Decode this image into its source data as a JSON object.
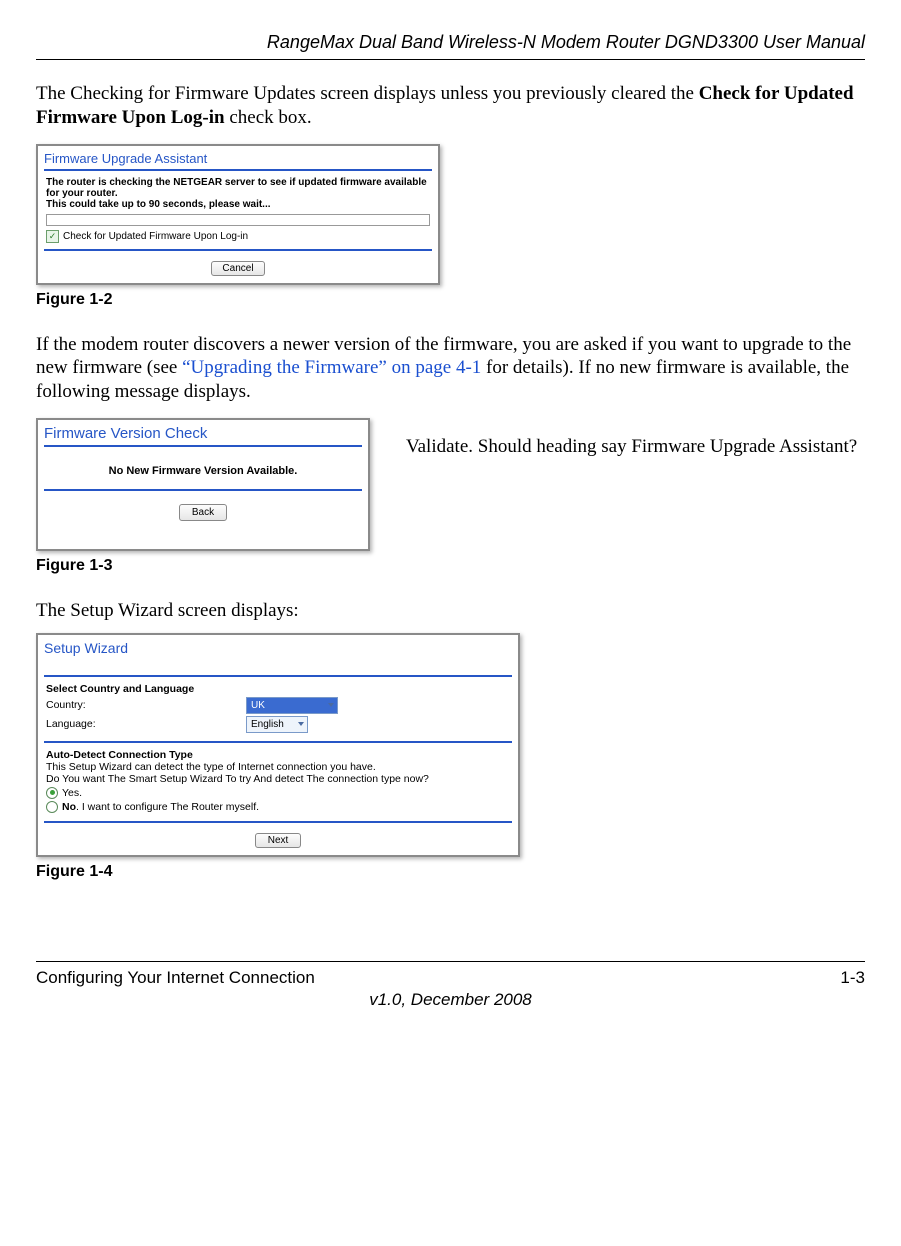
{
  "header": {
    "title": "RangeMax Dual Band Wireless-N Modem Router DGND3300 User Manual"
  },
  "para1_a": "The Checking for Firmware Updates screen displays unless you previously cleared the ",
  "para1_b_bold": "Check for Updated Firmware Upon Log-in",
  "para1_c": " check box.",
  "fig1": {
    "title": "Firmware Upgrade Assistant",
    "line1": "The router is checking the NETGEAR server to see if updated firmware available for your router.",
    "line2": "This could take up to 90 seconds, please wait...",
    "check_label": "Check for Updated Firmware Upon Log-in",
    "button": "Cancel",
    "caption": "Figure 1-2"
  },
  "para2_a": "If the modem router discovers a newer version of the firmware, you are asked if you want to upgrade to the new firmware (see ",
  "para2_link": "“Upgrading the Firmware” on page 4-1",
  "para2_b": " for details). If no new firmware is available, the following message displays.",
  "fig2": {
    "title": "Firmware Version Check",
    "message": "No New Firmware Version Available.",
    "button": "Back",
    "caption": "Figure 1-3"
  },
  "annotation": "Validate. Should heading say Firmware Upgrade Assistant?",
  "para3": "The Setup Wizard screen displays:",
  "fig3": {
    "title": "Setup Wizard",
    "section1": "Select Country and Language",
    "country_label": "Country:",
    "country_value": "UK",
    "language_label": "Language:",
    "language_value": "English",
    "section2": "Auto-Detect Connection Type",
    "desc1": "This Setup Wizard can detect the type of Internet connection you have.",
    "desc2": "Do You want The Smart Setup Wizard To try And detect The connection type now?",
    "opt_yes": "Yes.",
    "opt_no_a": "No",
    "opt_no_b": ". I want to configure The Router myself.",
    "button": "Next",
    "caption": "Figure 1-4"
  },
  "footer": {
    "left": "Configuring Your Internet Connection",
    "right": "1-3",
    "center": "v1.0, December 2008"
  }
}
